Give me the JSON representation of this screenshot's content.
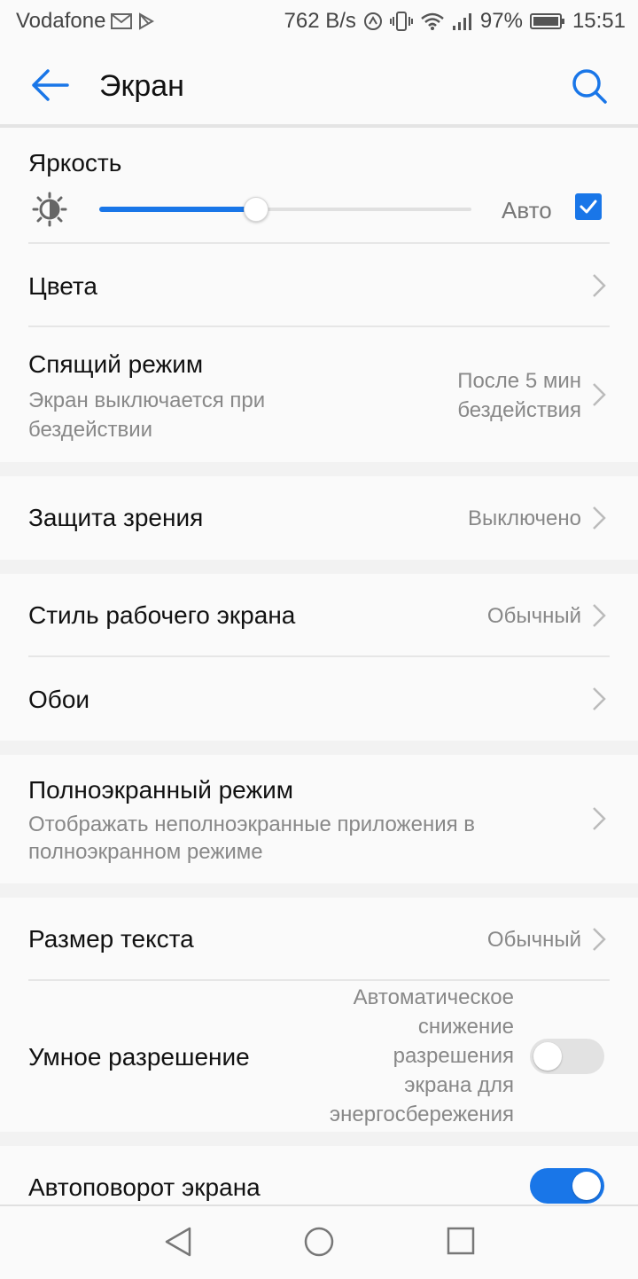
{
  "status_bar": {
    "carrier": "Vodafone",
    "speed": "762 B/s",
    "battery": "97%",
    "time": "15:51"
  },
  "app_bar": {
    "title": "Экран",
    "icons": [
      "back-arrow-icon",
      "search-icon"
    ]
  },
  "brightness": {
    "label": "Яркость",
    "level": 0.42,
    "auto_label": "Авто",
    "auto_checked": true
  },
  "items": {
    "colors": {
      "label": "Цвета"
    },
    "sleep": {
      "label": "Спящий режим",
      "subtitle_line1": "Экран выключается при",
      "subtitle_line2": "бездействии",
      "value_line1": "После 5 мин",
      "value_line2": "бездействия"
    },
    "eye_comfort": {
      "label": "Защита зрения",
      "value": "Выключено"
    },
    "home_style": {
      "label": "Стиль рабочего экрана",
      "value": "Обычный"
    },
    "wallpaper": {
      "label": "Обои"
    },
    "fullscreen": {
      "label": "Полноэкранный режим",
      "subtitle_line1": "Отображать неполноэкранные приложения в",
      "subtitle_line2": "полноэкранном режиме"
    },
    "text_size": {
      "label": "Размер текста",
      "value": "Обычный"
    },
    "smart_resolution": {
      "label": "Умное разрешение",
      "desc_lines": [
        "Автоматическое",
        "снижение",
        "разрешения",
        "экрана для",
        "энергосбережения"
      ],
      "enabled": false
    },
    "auto_rotate": {
      "label": "Автоповорот экрана",
      "enabled": true
    }
  },
  "colors": {
    "accent": "#1976e8",
    "toggle_off": "#e2e2e2",
    "secondary_text": "#888888"
  },
  "nav_bar": {
    "icons": [
      "back-triangle-icon",
      "home-circle-icon",
      "recents-square-icon"
    ]
  }
}
